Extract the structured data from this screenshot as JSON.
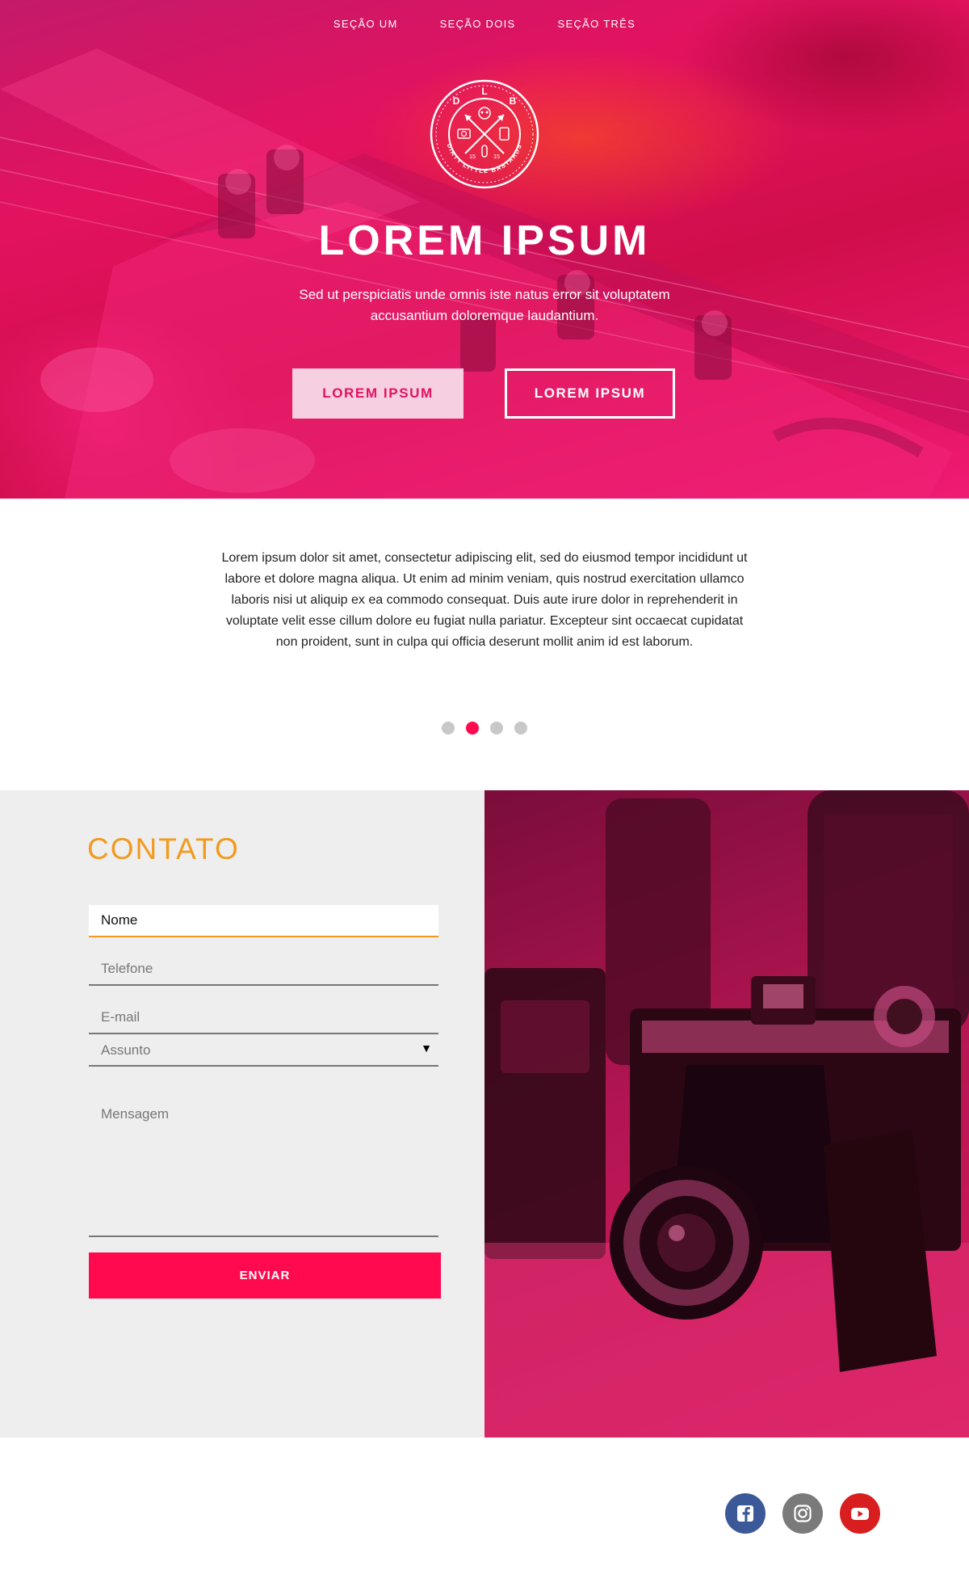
{
  "nav": {
    "items": [
      {
        "label": "SEÇÃO UM"
      },
      {
        "label": "SEÇÃO DOIS"
      },
      {
        "label": "SEÇÃO TRÊS"
      }
    ]
  },
  "logo": {
    "top_letters": [
      "D",
      "L",
      "B"
    ],
    "ring_text": "DIRTY LITTLE BASTARDS",
    "year_left": "15",
    "year_right": "15"
  },
  "hero": {
    "title": "LOREM IPSUM",
    "subtitle": "Sed ut perspiciatis unde omnis iste natus error sit voluptatem accusantium doloremque laudantium.",
    "primary_button": "LOREM IPSUM",
    "secondary_button": "LOREM IPSUM"
  },
  "about": {
    "text": "Lorem ipsum dolor sit amet, consectetur adipiscing elit, sed do eiusmod tempor incididunt ut labore et dolore magna aliqua. Ut enim ad minim veniam, quis nostrud exercitation ullamco laboris nisi ut aliquip ex ea commodo consequat. Duis aute irure dolor in reprehenderit in voluptate velit esse cillum dolore eu fugiat nulla pariatur. Excepteur sint occaecat cupidatat non proident, sunt in culpa qui officia deserunt mollit anim id est laborum."
  },
  "carousel": {
    "count": 4,
    "active_index": 1
  },
  "contact": {
    "title": "CONTATO",
    "name_value": "Nome",
    "phone_placeholder": "Telefone",
    "email_placeholder": "E-mail",
    "subject_placeholder": "Assunto",
    "message_placeholder": "Mensagem",
    "submit_label": "ENVIAR"
  },
  "social": {
    "items": [
      {
        "icon": "facebook-icon",
        "color": "#3b5998"
      },
      {
        "icon": "instagram-icon",
        "color": "#7a7a7a"
      },
      {
        "icon": "youtube-icon",
        "color": "#d81e1e"
      }
    ]
  },
  "colors": {
    "accent": "#ff0a4f",
    "contact_title": "#f29a1f",
    "hero_overlay": "#e3125f",
    "dot_inactive": "#c8c8c8"
  }
}
